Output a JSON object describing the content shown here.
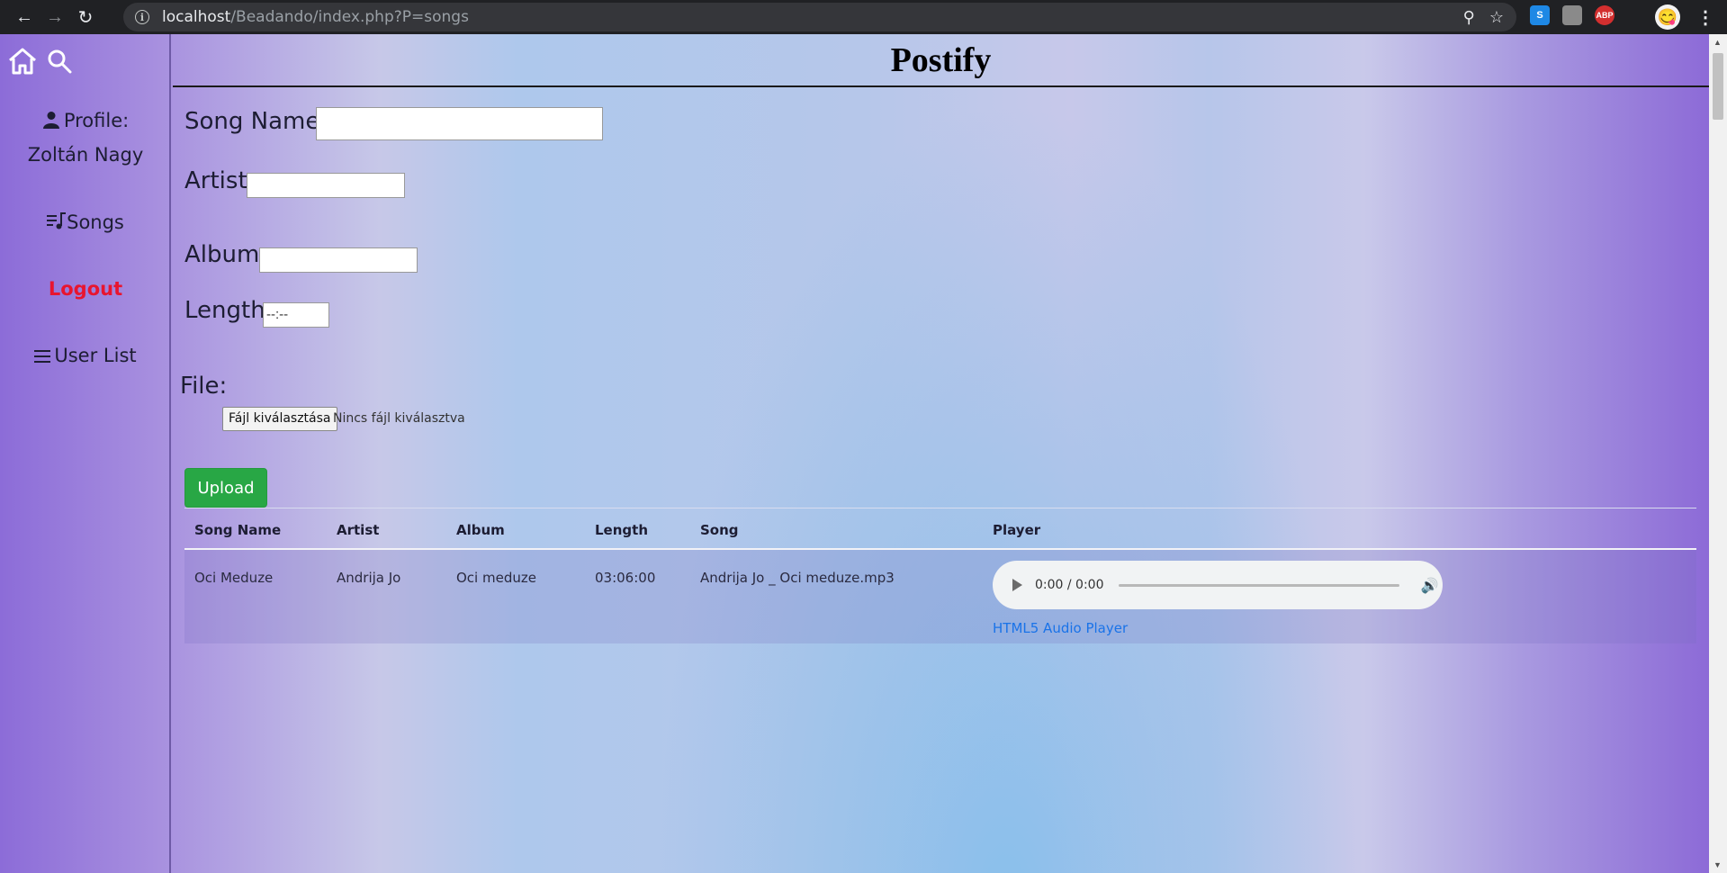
{
  "browser": {
    "url_host": "localhost",
    "url_path": "/Beadando/index.php?P=songs"
  },
  "sidebar": {
    "profile_label": "Profile:",
    "profile_name": "Zoltán Nagy",
    "songs_label": "Songs",
    "logout_label": "Logout",
    "user_list_label": "User List"
  },
  "header": {
    "title": "Postify"
  },
  "form": {
    "song_name_label": "Song Name",
    "artist_label": "Artist",
    "album_label": "Album",
    "length_label": "Length",
    "length_value": "--:--",
    "file_label": "File:",
    "file_button": "Fájl kiválasztása",
    "file_status": "Nincs fájl kiválasztva",
    "upload_label": "Upload"
  },
  "table": {
    "headers": [
      "Song Name",
      "Artist",
      "Album",
      "Length",
      "Song",
      "Player"
    ],
    "rows": [
      {
        "song_name": "Oci Meduze",
        "artist": "Andrija Jo",
        "album": "Oci meduze",
        "length": "03:06:00",
        "song": "Andrija Jo _ Oci meduze.mp3",
        "player_time": "0:00 / 0:00",
        "player_link": "HTML5 Audio Player"
      }
    ]
  },
  "extensions": {
    "s_label": "S",
    "abp_label": "ABP"
  }
}
